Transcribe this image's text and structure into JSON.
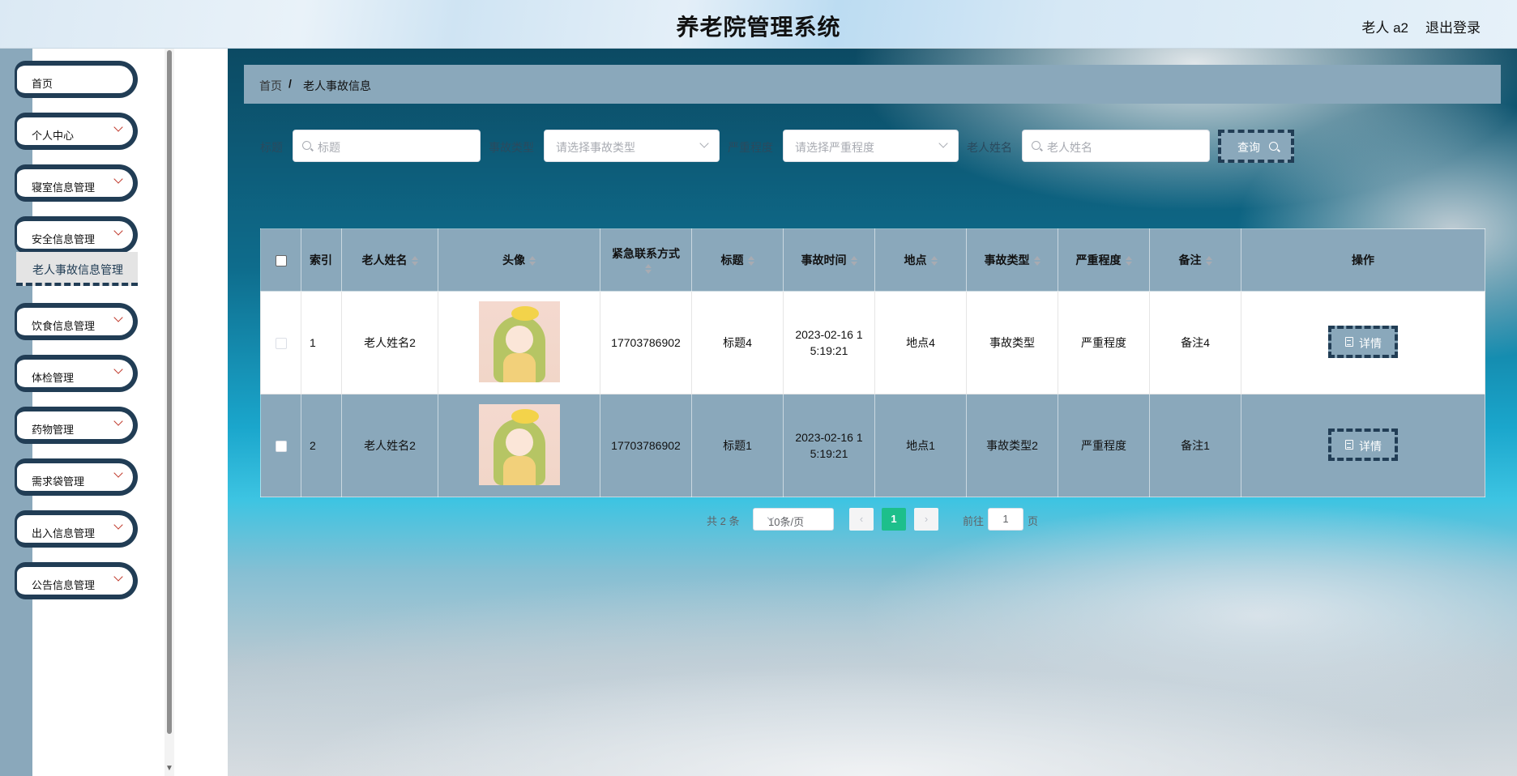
{
  "header": {
    "title": "养老院管理系统",
    "user": "老人 a2",
    "logout": "退出登录"
  },
  "sidebar": {
    "items": [
      {
        "label": "首页"
      },
      {
        "label": "个人中心"
      },
      {
        "label": "寝室信息管理"
      },
      {
        "label": "安全信息管理"
      },
      {
        "label": "饮食信息管理"
      },
      {
        "label": "体检管理"
      },
      {
        "label": "药物管理"
      },
      {
        "label": "需求袋管理"
      },
      {
        "label": "出入信息管理"
      },
      {
        "label": "公告信息管理"
      }
    ],
    "active_sub": "老人事故信息管理"
  },
  "breadcrumb": {
    "home": "首页",
    "separator": "/",
    "current": "老人事故信息"
  },
  "search": {
    "label_title": "标题",
    "ph_title": "标题",
    "label_type": "事故类型",
    "ph_type": "请选择事故类型",
    "label_severity": "严重程度",
    "ph_severity": "请选择严重程度",
    "label_name": "老人姓名",
    "ph_name": "老人姓名",
    "query": "查询"
  },
  "table": {
    "headers": [
      "索引",
      "老人姓名",
      "头像",
      "紧急联系方式",
      "标题",
      "事故时间",
      "地点",
      "事故类型",
      "严重程度",
      "备注",
      "操作"
    ],
    "rows": [
      {
        "index": "1",
        "name": "老人姓名2",
        "phone": "17703786902",
        "title": "标题4",
        "time_a": "2023-02-16 1",
        "time_b": "5:19:21",
        "place": "地点4",
        "type": "事故类型",
        "severity": "严重程度",
        "note": "备注4",
        "action": "详情"
      },
      {
        "index": "2",
        "name": "老人姓名2",
        "phone": "17703786902",
        "title": "标题1",
        "time_a": "2023-02-16 1",
        "time_b": "5:19:21",
        "place": "地点1",
        "type": "事故类型2",
        "severity": "严重程度",
        "note": "备注1",
        "action": "详情"
      }
    ]
  },
  "pagination": {
    "total": "共 2 条",
    "page_size": "10条/页",
    "prev": "‹",
    "current_page": "1",
    "next": "›",
    "goto_label": "前往",
    "goto_value": "1",
    "goto_unit": "页"
  },
  "colors": {
    "accent": "#8aa8bb",
    "dark": "#213d55",
    "active_page": "#1dbf8b"
  }
}
